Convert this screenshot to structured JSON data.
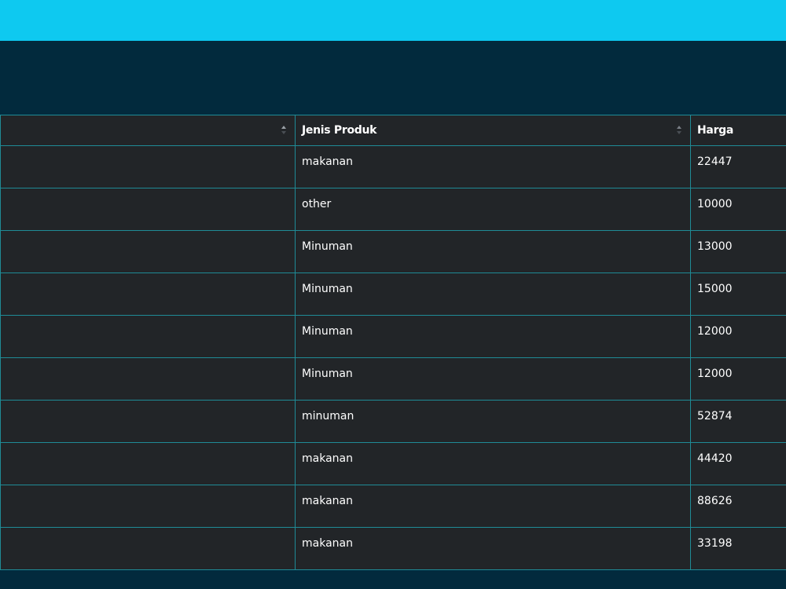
{
  "header": {
    "accent_color": "#0ec9f0",
    "background_color": "#022a3d"
  },
  "table": {
    "columns": [
      {
        "label": "",
        "sortable": true
      },
      {
        "label": "Jenis Produk",
        "sortable": true
      },
      {
        "label": "Harga",
        "sortable": false
      }
    ],
    "rows": [
      {
        "jenis": "makanan",
        "harga": "22447"
      },
      {
        "jenis": "other",
        "harga": "10000"
      },
      {
        "jenis": "Minuman",
        "harga": "13000"
      },
      {
        "jenis": "Minuman",
        "harga": "15000"
      },
      {
        "jenis": "Minuman",
        "harga": "12000"
      },
      {
        "jenis": "Minuman",
        "harga": "12000"
      },
      {
        "jenis": "minuman",
        "harga": "52874"
      },
      {
        "jenis": "makanan",
        "harga": "44420"
      },
      {
        "jenis": "makanan",
        "harga": "88626"
      },
      {
        "jenis": "makanan",
        "harga": "33198"
      }
    ]
  },
  "icons": {
    "sort": "sort-arrows-icon"
  }
}
